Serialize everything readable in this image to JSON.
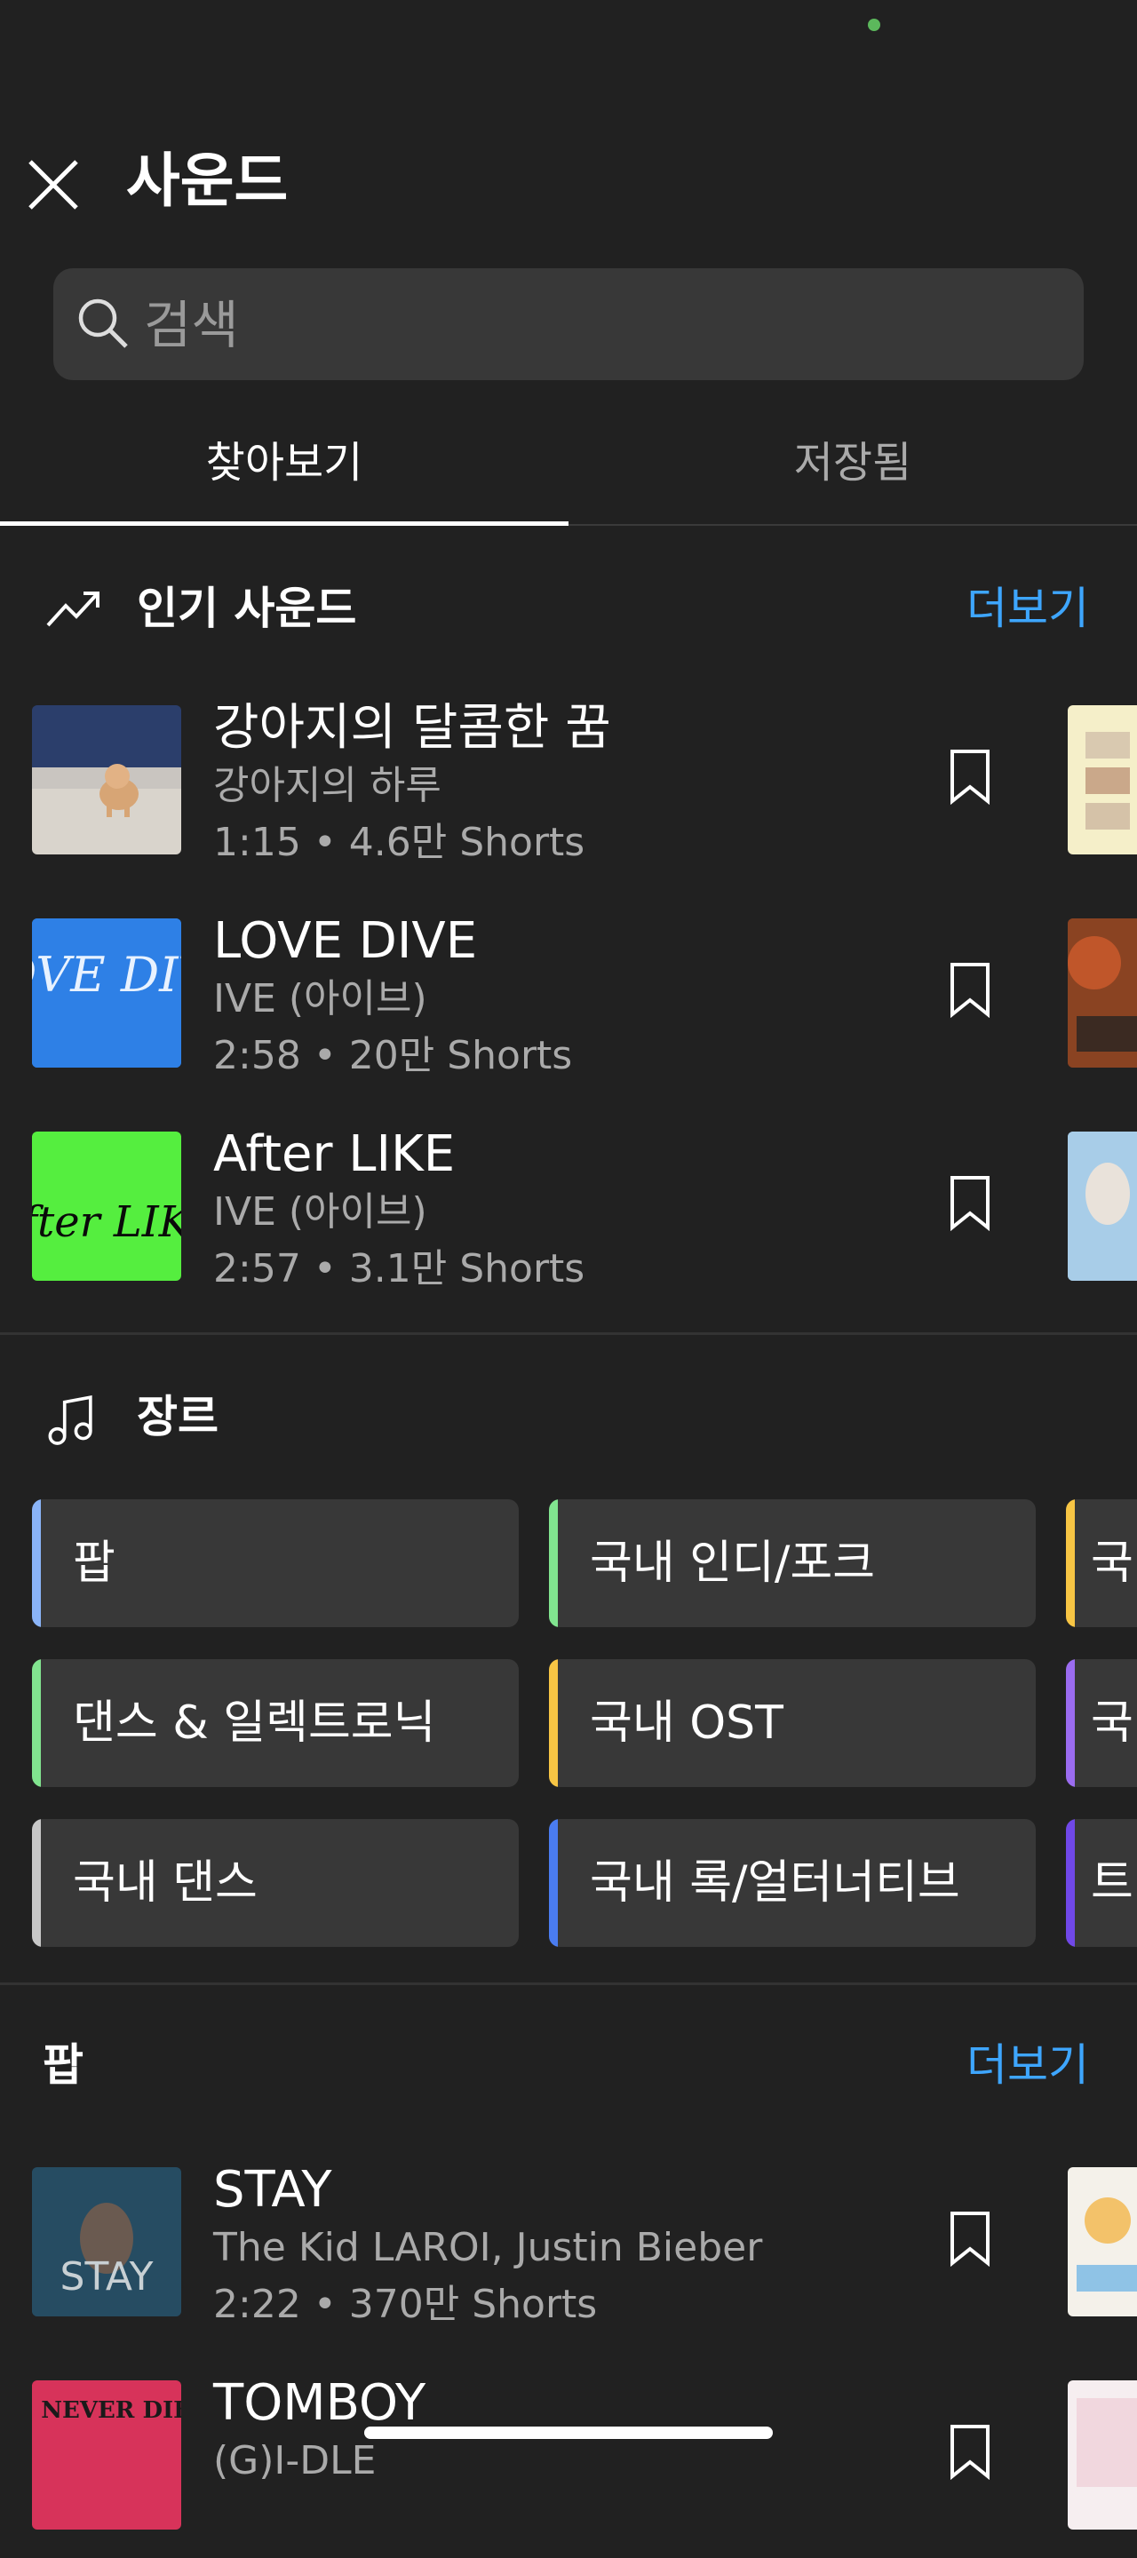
{
  "header": {
    "title": "사운드"
  },
  "search": {
    "placeholder": "검색"
  },
  "tabs": [
    {
      "label": "찾아보기"
    },
    {
      "label": "저장됨"
    }
  ],
  "popular": {
    "title": "인기 사운드",
    "more": "더보기",
    "tracks": [
      {
        "title": "강아지의 달콤한 꿈",
        "artist": "강아지의 하루",
        "duration": "1:15",
        "shorts": "4.6만 Shorts",
        "thumb_text": ""
      },
      {
        "title": "LOVE DIVE",
        "artist": "IVE (아이브)",
        "duration": "2:58",
        "shorts": "20만 Shorts",
        "thumb_text": "LOVE DIVE"
      },
      {
        "title": "After LIKE",
        "artist": "IVE (아이브)",
        "duration": "2:57",
        "shorts": "3.1만 Shorts",
        "thumb_text": "After LIKE"
      }
    ]
  },
  "genres": {
    "title": "장르",
    "items": [
      {
        "label": "팝",
        "color": "#8ab4f8"
      },
      {
        "label": "국내 인디/포크",
        "color": "#81e48f"
      },
      {
        "label": "국",
        "color": "#f7c544"
      },
      {
        "label": "댄스 & 일렉트로닉",
        "color": "#81e48f"
      },
      {
        "label": "국내 OST",
        "color": "#f7c544"
      },
      {
        "label": "국",
        "color": "#9b6cf0"
      },
      {
        "label": "국내 댄스",
        "color": "#c8c8c8"
      },
      {
        "label": "국내 록/얼터너티브",
        "color": "#4a7cf0"
      },
      {
        "label": "트",
        "color": "#7048e8"
      }
    ]
  },
  "pop": {
    "title": "팝",
    "more": "더보기",
    "tracks": [
      {
        "title": "STAY",
        "artist": "The Kid LAROI, Justin Bieber",
        "duration": "2:22",
        "shorts": "370만 Shorts",
        "thumb_text": "STAY"
      },
      {
        "title": "TOMBOY",
        "artist": "(G)I-DLE",
        "duration": "",
        "shorts": "",
        "thumb_text": "I NEVER DIE"
      }
    ]
  },
  "separator": "•",
  "colors": {
    "background": "#212121",
    "accent": "#3ea6ff",
    "secondary_text": "#aaaaaa"
  }
}
